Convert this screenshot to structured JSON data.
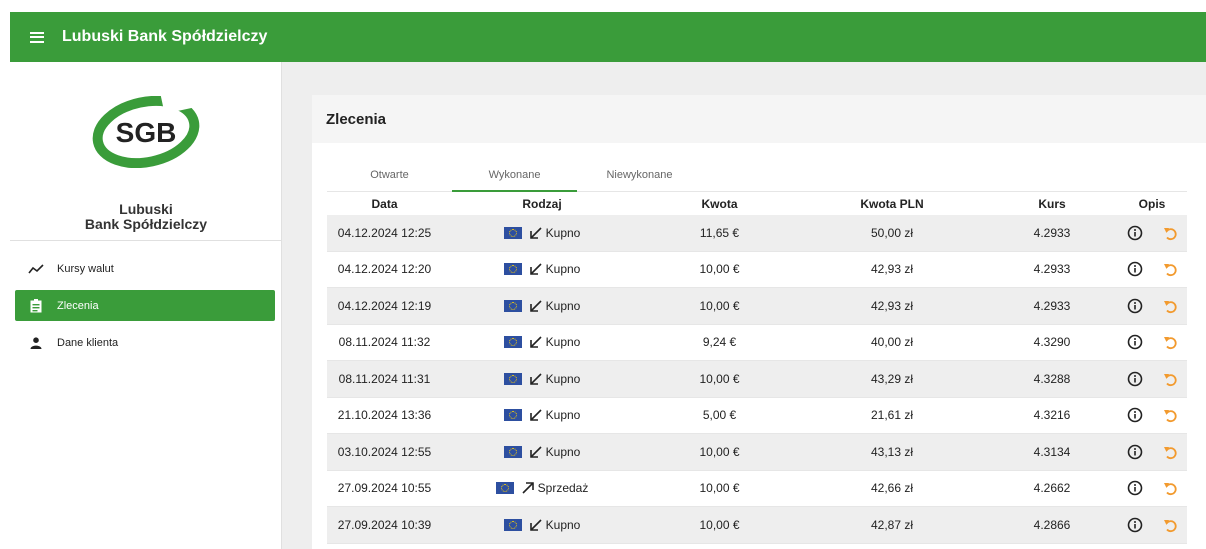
{
  "app": {
    "title": "Lubuski Bank Spółdzielczy"
  },
  "brand": {
    "logo_text": "SGB",
    "bank_name_line1": "Lubuski",
    "bank_name_line2": "Bank Spółdzielczy",
    "accent": "#3a9c3a"
  },
  "sidebar": {
    "items": [
      {
        "label": "Kursy walut",
        "icon": "trending-icon"
      },
      {
        "label": "Zlecenia",
        "icon": "clipboard-icon",
        "active": true
      },
      {
        "label": "Dane klienta",
        "icon": "person-icon"
      }
    ]
  },
  "panel": {
    "title": "Zlecenia",
    "tabs": [
      "Otwarte",
      "Wykonane",
      "Niewykonane"
    ],
    "active_tab": "Wykonane"
  },
  "table": {
    "headers": {
      "date": "Data",
      "type": "Rodzaj",
      "amount": "Kwota",
      "amount_pln": "Kwota PLN",
      "rate": "Kurs",
      "desc": "Opis"
    },
    "rows": [
      {
        "date": "04.12.2024 12:25",
        "type": "Kupno",
        "dir": "buy",
        "amount": "11,65 €",
        "amount_pln": "50,00 zł",
        "rate": "4.2933"
      },
      {
        "date": "04.12.2024 12:20",
        "type": "Kupno",
        "dir": "buy",
        "amount": "10,00 €",
        "amount_pln": "42,93 zł",
        "rate": "4.2933"
      },
      {
        "date": "04.12.2024 12:19",
        "type": "Kupno",
        "dir": "buy",
        "amount": "10,00 €",
        "amount_pln": "42,93 zł",
        "rate": "4.2933"
      },
      {
        "date": "08.11.2024 11:32",
        "type": "Kupno",
        "dir": "buy",
        "amount": "9,24 €",
        "amount_pln": "40,00 zł",
        "rate": "4.3290"
      },
      {
        "date": "08.11.2024 11:31",
        "type": "Kupno",
        "dir": "buy",
        "amount": "10,00 €",
        "amount_pln": "43,29 zł",
        "rate": "4.3288"
      },
      {
        "date": "21.10.2024 13:36",
        "type": "Kupno",
        "dir": "buy",
        "amount": "5,00 €",
        "amount_pln": "21,61 zł",
        "rate": "4.3216"
      },
      {
        "date": "03.10.2024 12:55",
        "type": "Kupno",
        "dir": "buy",
        "amount": "10,00 €",
        "amount_pln": "43,13 zł",
        "rate": "4.3134"
      },
      {
        "date": "27.09.2024 10:55",
        "type": "Sprzedaż",
        "dir": "sell",
        "amount": "10,00 €",
        "amount_pln": "42,66 zł",
        "rate": "4.2662"
      },
      {
        "date": "27.09.2024 10:39",
        "type": "Kupno",
        "dir": "buy",
        "amount": "10,00 €",
        "amount_pln": "42,87 zł",
        "rate": "4.2866"
      }
    ]
  },
  "colors": {
    "header_green": "#3a9c3a",
    "undo_orange": "#f29a2e",
    "eu_flag": "#2d4fa0"
  }
}
